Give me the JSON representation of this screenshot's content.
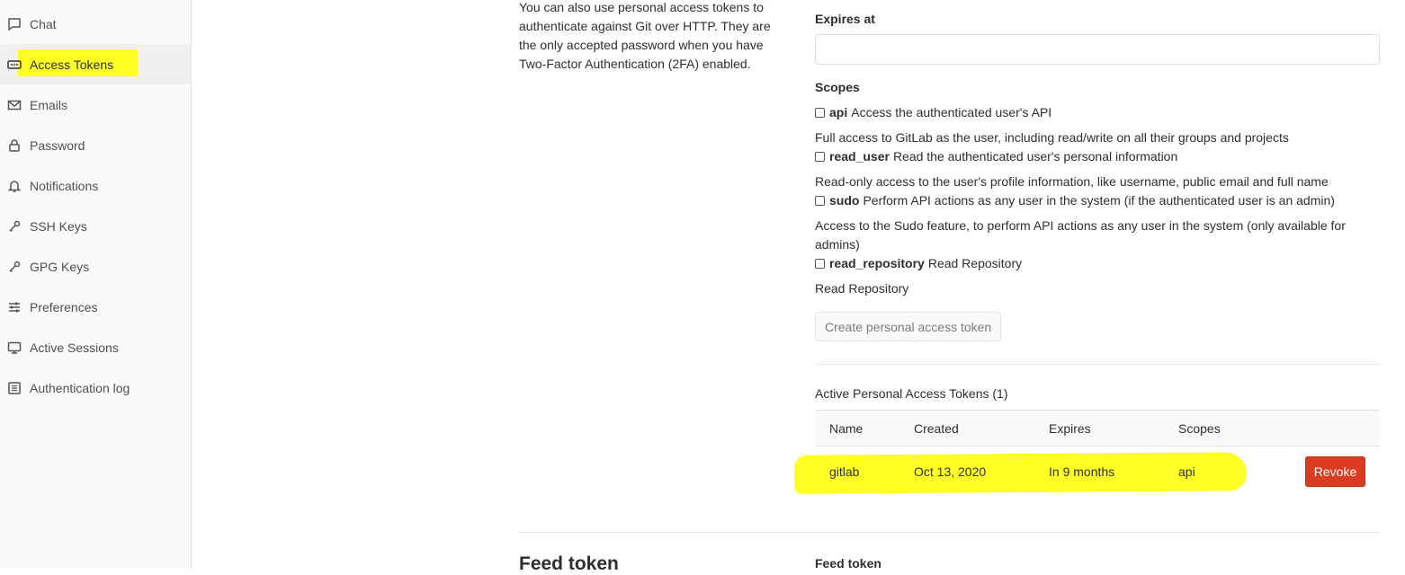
{
  "sidebar": {
    "items": [
      {
        "label": "Chat",
        "icon": "chat-icon"
      },
      {
        "label": "Access Tokens",
        "icon": "token-icon",
        "active": true
      },
      {
        "label": "Emails",
        "icon": "mail-icon"
      },
      {
        "label": "Password",
        "icon": "lock-icon"
      },
      {
        "label": "Notifications",
        "icon": "bell-icon"
      },
      {
        "label": "SSH Keys",
        "icon": "key-icon"
      },
      {
        "label": "GPG Keys",
        "icon": "key-icon"
      },
      {
        "label": "Preferences",
        "icon": "sliders-icon"
      },
      {
        "label": "Active Sessions",
        "icon": "monitor-icon"
      },
      {
        "label": "Authentication log",
        "icon": "log-icon"
      }
    ]
  },
  "intro": {
    "text": "You can also use personal access tokens to authenticate against Git over HTTP. They are the only accepted password when you have Two-Factor Authentication (2FA) enabled."
  },
  "form": {
    "expires_label": "Expires at",
    "expires_value": "",
    "scopes_label": "Scopes",
    "scopes": [
      {
        "name": "api",
        "desc": "Access the authenticated user's API",
        "help": "Full access to GitLab as the user, including read/write on all their groups and projects"
      },
      {
        "name": "read_user",
        "desc": "Read the authenticated user's personal information",
        "help": "Read-only access to the user's profile information, like username, public email and full name"
      },
      {
        "name": "sudo",
        "desc": "Perform API actions as any user in the system (if the authenticated user is an admin)",
        "help": "Access to the Sudo feature, to perform API actions as any user in the system (only available for admins)"
      },
      {
        "name": "read_repository",
        "desc": "Read Repository",
        "help": "Read Repository"
      }
    ],
    "create_button": "Create personal access token"
  },
  "active_tokens": {
    "title": "Active Personal Access Tokens (1)",
    "columns": [
      "Name",
      "Created",
      "Expires",
      "Scopes"
    ],
    "rows": [
      {
        "name": "gitlab",
        "created": "Oct 13, 2020",
        "expires": "In 9 months",
        "scopes": "api",
        "action": "Revoke"
      }
    ]
  },
  "feed": {
    "title": "Feed token",
    "label": "Feed token"
  },
  "colors": {
    "highlight": "#ffff26",
    "danger": "#db3b21",
    "sidebar_bg": "#fafafa"
  }
}
